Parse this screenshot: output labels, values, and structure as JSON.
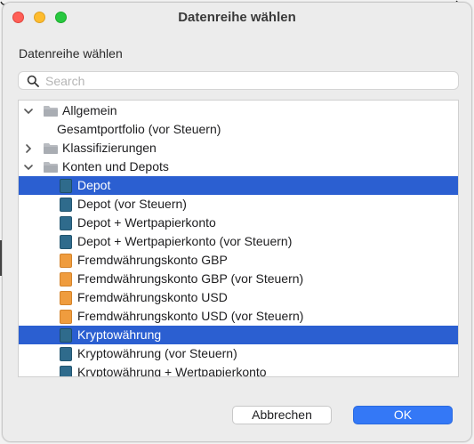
{
  "window": {
    "title": "Datenreihe wählen"
  },
  "section_label": "Datenreihe wählen",
  "search": {
    "placeholder": "Search",
    "value": ""
  },
  "tree": [
    {
      "label": "Allgemein",
      "kind": "group",
      "expanded": true,
      "selected": false,
      "icon": "folder-icon"
    },
    {
      "label": "Gesamtportfolio (vor Steuern)",
      "kind": "item",
      "selected": false,
      "icon": "none"
    },
    {
      "label": "Klassifizierungen",
      "kind": "group",
      "expanded": false,
      "selected": false,
      "icon": "folder-icon"
    },
    {
      "label": "Konten und Depots",
      "kind": "group",
      "expanded": true,
      "selected": false,
      "icon": "folder-icon"
    },
    {
      "label": "Depot",
      "kind": "item",
      "selected": true,
      "icon": "portfolio-book-icon"
    },
    {
      "label": "Depot (vor Steuern)",
      "kind": "item",
      "selected": false,
      "icon": "portfolio-book-icon"
    },
    {
      "label": "Depot + Wertpapierkonto",
      "kind": "item",
      "selected": false,
      "icon": "portfolio-book-icon"
    },
    {
      "label": "Depot + Wertpapierkonto (vor Steuern)",
      "kind": "item",
      "selected": false,
      "icon": "portfolio-book-icon"
    },
    {
      "label": "Fremdwährungskonto GBP",
      "kind": "item",
      "selected": false,
      "icon": "account-book-icon"
    },
    {
      "label": "Fremdwährungskonto GBP (vor Steuern)",
      "kind": "item",
      "selected": false,
      "icon": "account-book-icon"
    },
    {
      "label": "Fremdwährungskonto USD",
      "kind": "item",
      "selected": false,
      "icon": "account-book-icon"
    },
    {
      "label": "Fremdwährungskonto USD (vor Steuern)",
      "kind": "item",
      "selected": false,
      "icon": "account-book-icon"
    },
    {
      "label": "Kryptowährung",
      "kind": "item",
      "selected": true,
      "icon": "portfolio-book-icon"
    },
    {
      "label": "Kryptowährung (vor Steuern)",
      "kind": "item",
      "selected": false,
      "icon": "portfolio-book-icon"
    },
    {
      "label": "Kryptowährung + Wertpapierkonto",
      "kind": "item",
      "selected": false,
      "icon": "portfolio-book-icon"
    }
  ],
  "buttons": {
    "cancel": "Abbrechen",
    "ok": "OK"
  },
  "colors": {
    "selection": "#2b5fd1",
    "ok_button": "#3478f6",
    "portfolio_icon": "#2f6b8c",
    "account_icon": "#ef9c3e"
  }
}
